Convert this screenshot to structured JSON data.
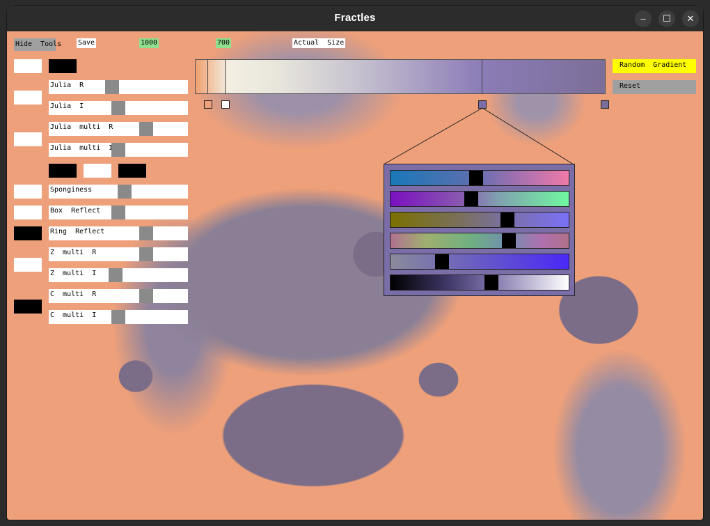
{
  "window": {
    "title": "Fractles",
    "controls": {
      "minimize": "–",
      "maximize": "☐",
      "close": "✕"
    }
  },
  "toolbar": {
    "hide_tools": "Hide  Tools",
    "save": "Save",
    "width_value": "1000",
    "height_value": "700",
    "actual_size": "Actual  Size"
  },
  "sliders": [
    {
      "label": "Julia  R",
      "value": 0.45
    },
    {
      "label": "Julia  I",
      "value": 0.5
    },
    {
      "label": "Julia  multi  R",
      "value": 0.72
    },
    {
      "label": "Julia  multi  I",
      "value": 0.5
    },
    {
      "label": "Sponginess",
      "value": 0.55
    },
    {
      "label": "Box  Reflect",
      "value": 0.5
    },
    {
      "label": "Ring  Reflect",
      "value": 0.72
    },
    {
      "label": "Z  multi  R",
      "value": 0.72
    },
    {
      "label": "Z  multi  I",
      "value": 0.48
    },
    {
      "label": "C  multi  R",
      "value": 0.72
    },
    {
      "label": "C  multi  I",
      "value": 0.5
    }
  ],
  "buttons": {
    "random_gradient": "Random  Gradient",
    "reset": "Reset"
  },
  "colors": {
    "random_gradient_bg": "#ffff00",
    "reset_bg": "#a0a0a0",
    "editor_bg": "#7b6ea8"
  },
  "gradient_editor": {
    "channels": [
      {
        "name": "hue",
        "value": 0.48
      },
      {
        "name": "saturation",
        "value": 0.45
      },
      {
        "name": "value",
        "value": 0.67
      },
      {
        "name": "hue-2",
        "value": 0.68
      },
      {
        "name": "saturation-2",
        "value": 0.27
      },
      {
        "name": "brightness",
        "value": 0.57
      }
    ]
  }
}
